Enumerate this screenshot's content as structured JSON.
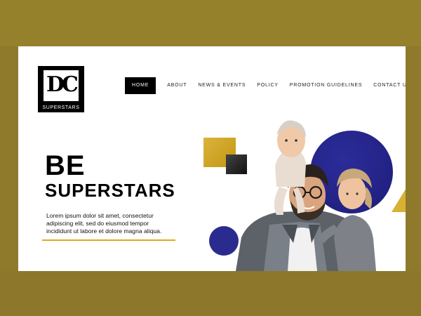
{
  "brand": {
    "logo_letters": "DC",
    "logo_sub": "SUPERSTARS"
  },
  "nav": {
    "items": [
      {
        "label": "HOME",
        "active": true
      },
      {
        "label": "ABOUT",
        "active": false
      },
      {
        "label": "NEWS & EVENTS",
        "active": false
      },
      {
        "label": "POLICY",
        "active": false
      },
      {
        "label": "PROMOTION GUIDELINES",
        "active": false
      },
      {
        "label": "CONTACT US",
        "active": false
      }
    ]
  },
  "hero": {
    "title_line1": "BE",
    "title_line2": "SUPERSTARS",
    "body": "Lorem ipsum dolor sit amet, consectetur adipiscing elit, sed do eiusmod tempor incididunt ut labore et dolore magna aliqua."
  },
  "colors": {
    "frame": "#8f7a2b",
    "accent_gold": "#e0a91c",
    "accent_navy": "#1d1d7a",
    "nav_active_bg": "#000000"
  },
  "icons": [
    "logo-mark"
  ]
}
